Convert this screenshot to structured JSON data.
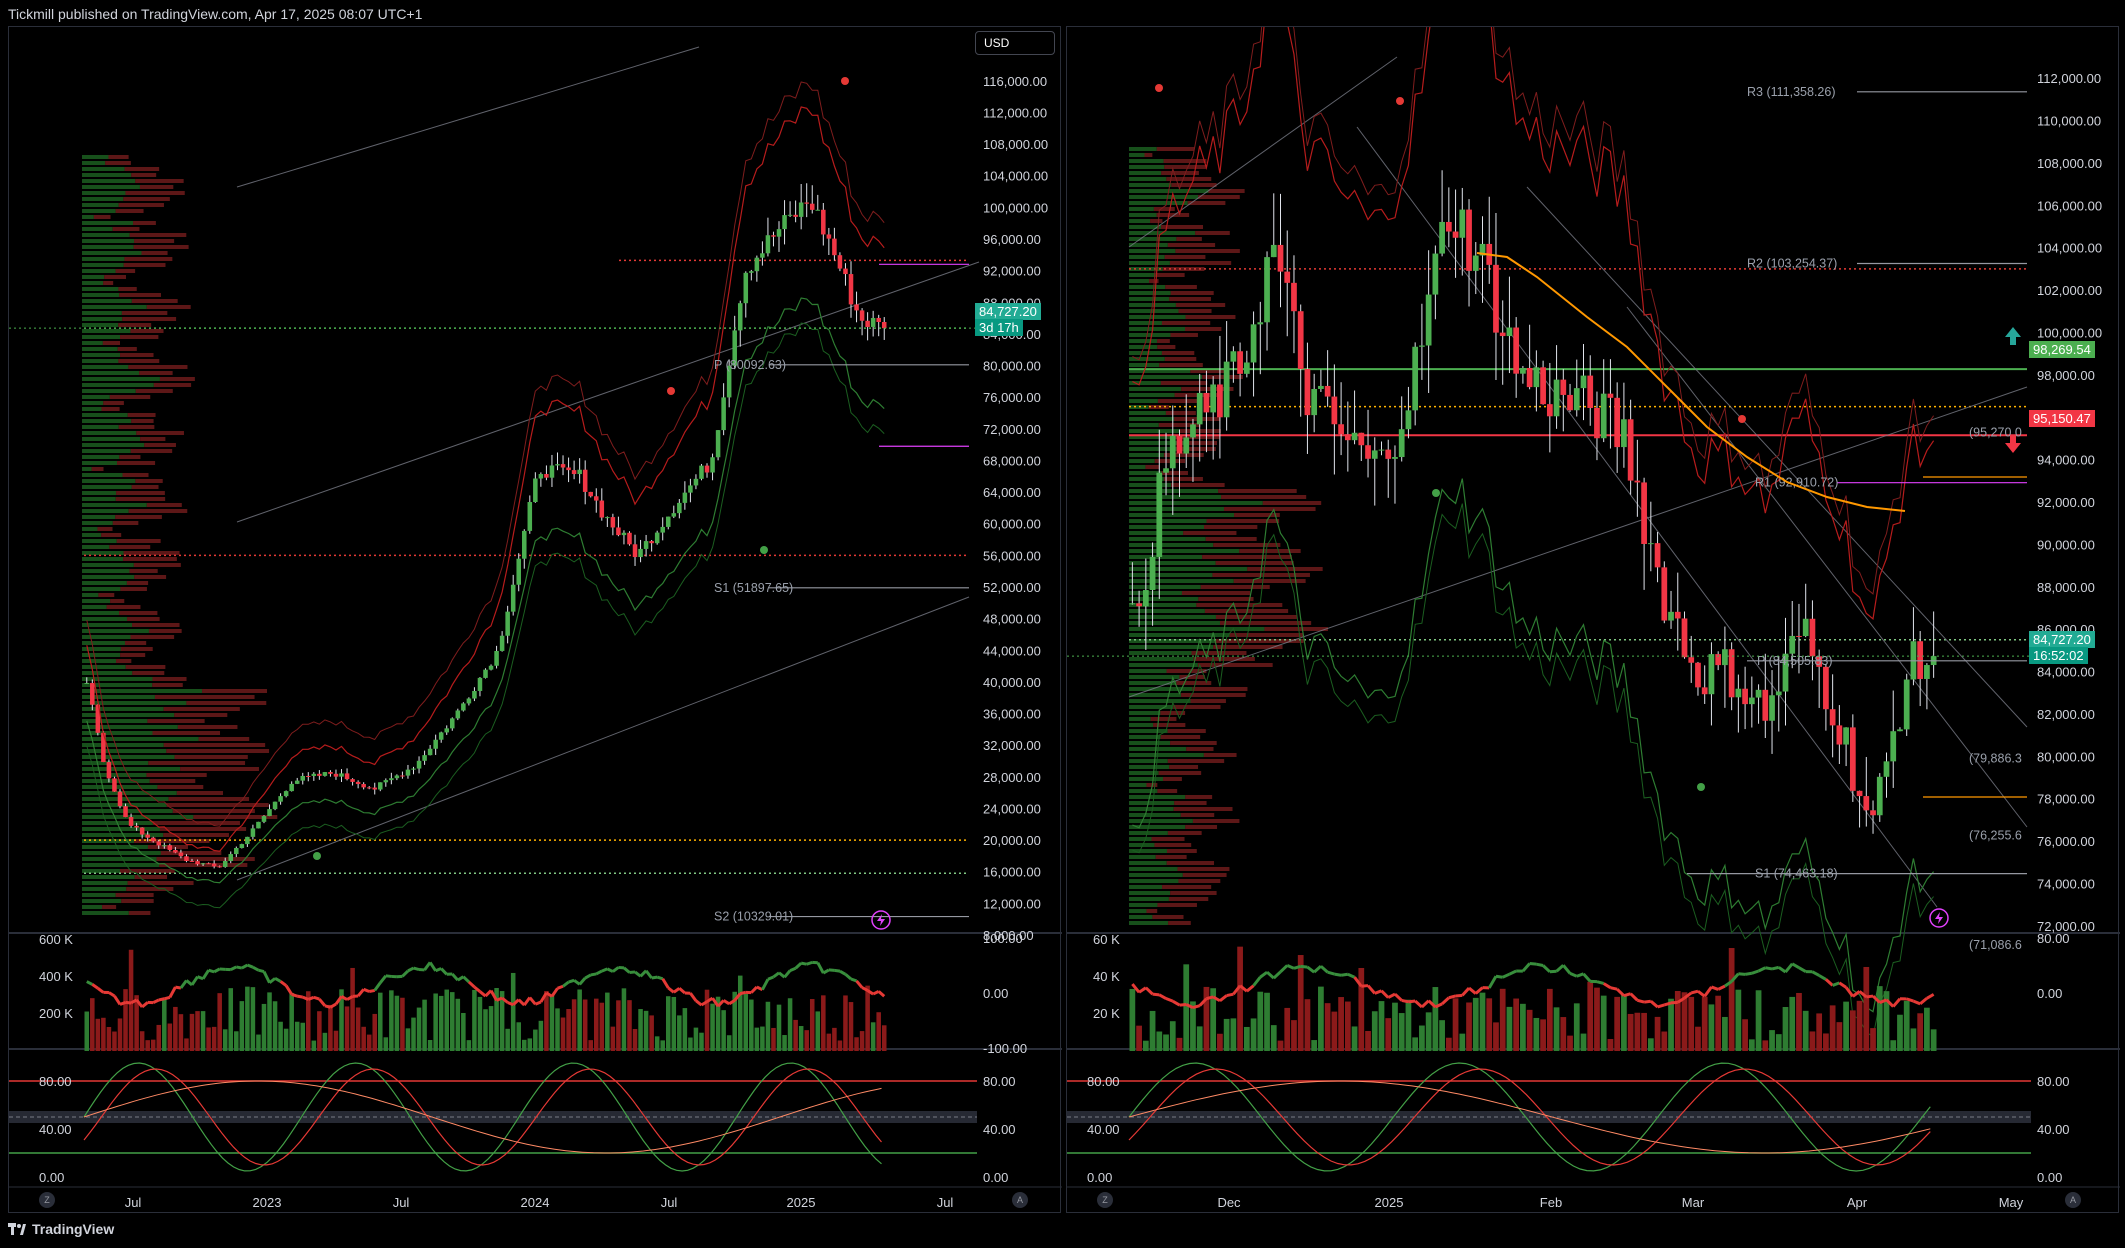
{
  "header": {
    "publisher_line": "Tickmill published on TradingView.com, Apr 17, 2025 08:07 UTC+1"
  },
  "footer": {
    "brand": "TradingView"
  },
  "colors": {
    "up": "#4caf50",
    "down": "#f23645",
    "pivot": "#9598a1",
    "accent_green": "#089981",
    "accent_red": "#f23645",
    "orange": "#ff9800",
    "violet": "#e040fb"
  },
  "left_chart": {
    "currency_button": "USD",
    "price_axis_ticks": [
      "116,000.00",
      "112,000.00",
      "108,000.00",
      "104,000.00",
      "100,000.00",
      "96,000.00",
      "92,000.00",
      "88,000.00",
      "84,000.00",
      "80,000.00",
      "76,000.00",
      "72,000.00",
      "68,000.00",
      "64,000.00",
      "60,000.00",
      "56,000.00",
      "52,000.00",
      "48,000.00",
      "44,000.00",
      "40,000.00",
      "36,000.00",
      "32,000.00",
      "28,000.00",
      "24,000.00",
      "20,000.00",
      "16,000.00",
      "12,000.00",
      "8,000.00"
    ],
    "last_price": "84,727.20",
    "countdown": "3d 17h",
    "pivot_labels": [
      "P (80092.63)",
      "S1 (51897.65)",
      "S2 (10329.01)"
    ],
    "volume_axis_left": [
      "600 K",
      "400 K",
      "200 K"
    ],
    "volume_axis_right": [
      "100.00",
      "0.00",
      "-100.00"
    ],
    "stoch_axis": [
      "80.00",
      "40.00",
      "0.00"
    ],
    "time_labels": [
      "Jul",
      "2023",
      "Jul",
      "2024",
      "Jul",
      "2025",
      "Jul"
    ],
    "corner_buttons": [
      "Z",
      "A"
    ]
  },
  "right_chart": {
    "price_axis_ticks": [
      "112,000.00",
      "110,000.00",
      "108,000.00",
      "106,000.00",
      "104,000.00",
      "102,000.00",
      "100,000.00",
      "98,000.00",
      "96,000.00",
      "94,000.00",
      "92,000.00",
      "90,000.00",
      "88,000.00",
      "86,000.00",
      "84,000.00",
      "82,000.00",
      "80,000.00",
      "78,000.00",
      "76,000.00",
      "74,000.00",
      "72,000.00"
    ],
    "last_price": "84,727.20",
    "countdown": "16:52:02",
    "green_level": "98,269.54",
    "red_level": "95,150.47",
    "pivot_labels": [
      "R3 (111,358.26)",
      "R2 (103,254.37)",
      "R1 (92,910.72)",
      "P (84,505.83)",
      "S1 (74,463.18)"
    ],
    "side_labels": [
      "(95,270.0",
      "(79,886.3",
      "(76,255.6",
      "(71,086.6"
    ],
    "volume_axis_left": [
      "60 K",
      "40 K",
      "20 K"
    ],
    "volume_axis_right": [
      "80.00",
      "0.00"
    ],
    "stoch_axis": [
      "80.00",
      "40.00",
      "0.00"
    ],
    "time_labels": [
      "Dec",
      "2025",
      "Feb",
      "Mar",
      "Apr",
      "May"
    ],
    "corner_buttons": [
      "Z",
      "A"
    ]
  },
  "chart_data": [
    {
      "type": "candlestick",
      "title": "",
      "timeframe_range": [
        "Jul 2022",
        "Apr 2025"
      ],
      "ylim": [
        8000,
        118000
      ],
      "x_ticks": [
        "Jul",
        "2023",
        "Jul",
        "2024",
        "Jul",
        "2025",
        "Jul"
      ],
      "close_path": [
        [
          0,
          40000
        ],
        [
          0.02,
          30000
        ],
        [
          0.05,
          22000
        ],
        [
          0.08,
          20000
        ],
        [
          0.12,
          17500
        ],
        [
          0.16,
          16500
        ],
        [
          0.2,
          21000
        ],
        [
          0.25,
          27500
        ],
        [
          0.3,
          28500
        ],
        [
          0.35,
          26500
        ],
        [
          0.4,
          29500
        ],
        [
          0.45,
          36000
        ],
        [
          0.5,
          44000
        ],
        [
          0.55,
          67000
        ],
        [
          0.6,
          66000
        ],
        [
          0.63,
          61000
        ],
        [
          0.67,
          56000
        ],
        [
          0.72,
          63000
        ],
        [
          0.76,
          68000
        ],
        [
          0.8,
          92000
        ],
        [
          0.84,
          97000
        ],
        [
          0.88,
          101000
        ],
        [
          0.91,
          94000
        ],
        [
          0.94,
          86000
        ],
        [
          0.97,
          84727
        ]
      ],
      "last": 84727.2,
      "pivots": {
        "P": 80092.63,
        "S1": 51897.65,
        "S2": 10329.01
      }
    },
    {
      "type": "candlestick",
      "title": "",
      "timeframe_range": [
        "Nov 2024",
        "Apr 2025"
      ],
      "ylim": [
        71000,
        113000
      ],
      "x_ticks": [
        "Dec",
        "2025",
        "Feb",
        "Mar",
        "Apr",
        "May"
      ],
      "close_path": [
        [
          0,
          86000
        ],
        [
          0.04,
          94000
        ],
        [
          0.08,
          96000
        ],
        [
          0.12,
          98000
        ],
        [
          0.16,
          104000
        ],
        [
          0.2,
          97000
        ],
        [
          0.24,
          95000
        ],
        [
          0.28,
          93500
        ],
        [
          0.32,
          98000
        ],
        [
          0.36,
          106000
        ],
        [
          0.4,
          103000
        ],
        [
          0.44,
          98000
        ],
        [
          0.48,
          97000
        ],
        [
          0.52,
          96500
        ],
        [
          0.56,
          95000
        ],
        [
          0.6,
          88000
        ],
        [
          0.64,
          84000
        ],
        [
          0.68,
          84000
        ],
        [
          0.72,
          82000
        ],
        [
          0.76,
          86000
        ],
        [
          0.8,
          82000
        ],
        [
          0.84,
          76500
        ],
        [
          0.88,
          84000
        ],
        [
          0.91,
          84727
        ]
      ],
      "last": 84727.2,
      "levels": {
        "green": 98269.54,
        "red": 95150.47
      },
      "pivots": {
        "R3": 111358.26,
        "R2": 103254.37,
        "R1": 92910.72,
        "P": 84505.83,
        "S1": 74463.18
      }
    }
  ]
}
